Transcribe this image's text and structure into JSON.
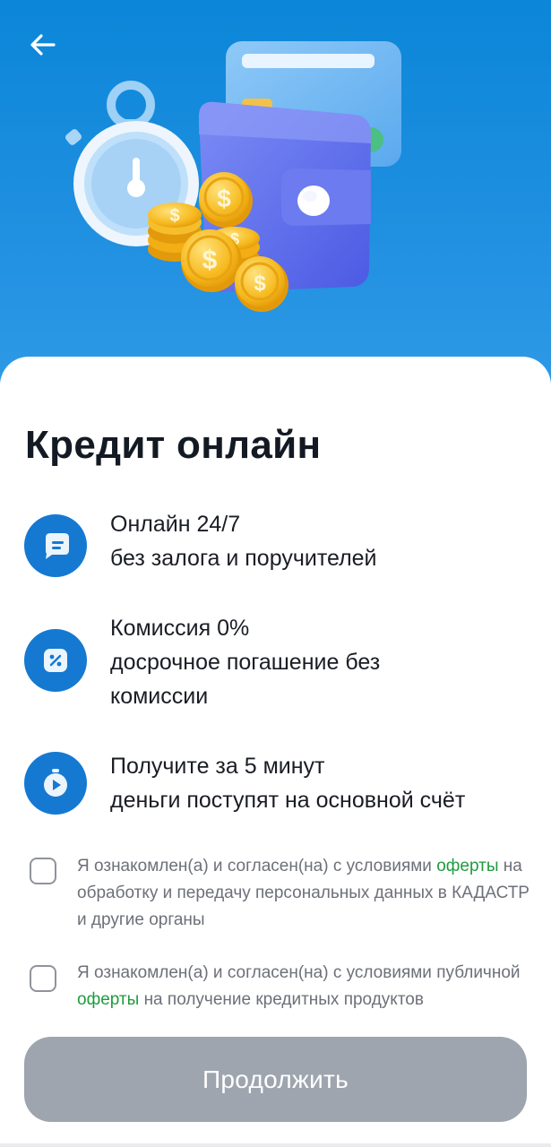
{
  "header": {
    "back_icon": "arrow-left-icon",
    "illustration": [
      "stopwatch",
      "wallet",
      "card",
      "coins-dollar"
    ]
  },
  "title": "Кредит онлайн",
  "features": [
    {
      "icon": "chat-bubble-icon",
      "title": "Онлайн 24/7",
      "lines": [
        "без залога и поручителей"
      ]
    },
    {
      "icon": "percent-icon",
      "title": "Комиссия 0%",
      "lines": [
        "досрочное погашение без",
        "комиссии"
      ]
    },
    {
      "icon": "timer-icon",
      "title": "Получите за 5 минут",
      "lines": [
        "деньги поступят на основной счёт"
      ]
    }
  ],
  "consents": [
    {
      "checked": false,
      "before": "Я ознакомлен(а) и согласен(на) с  условиями",
      "link": "оферты",
      "after": "на обработку и передачу персональных данных в КАДАСТР и другие органы"
    },
    {
      "checked": false,
      "before": "Я ознакомлен(а) и согласен(на) с условиями публичной",
      "link": "оферты",
      "after": "на получение кредитных продуктов"
    }
  ],
  "continue_label": "Продолжить",
  "colors": {
    "hero_blue": "#1f8fe0",
    "accent_blue": "#1579d2",
    "link_green": "#1f9b3f",
    "button_disabled": "#9ea5ae"
  }
}
